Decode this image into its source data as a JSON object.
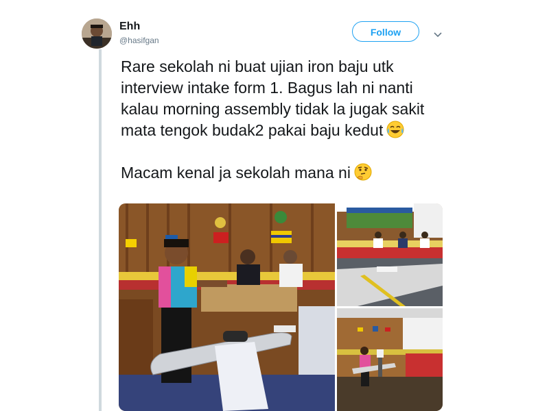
{
  "tweet": {
    "author": {
      "name": "Ehh",
      "handle": "@hasifgan",
      "avatar_icon": "user-avatar"
    },
    "follow_label": "Follow",
    "menu_icon": "chevron-down-icon",
    "paragraphs": [
      "Rare sekolah ni buat ujian iron baju utk interview intake form 1. Bagus lah ni nanti kalau morning assembly tidak la jugak sakit mata tengok budak2 pakai baju kedut",
      "Macam kenal ja sekolah mana ni"
    ],
    "emojis": [
      "face-with-tears-of-joy",
      "thinking-face"
    ],
    "media": {
      "count": 3,
      "photos": [
        "boy-ironing-shirt-meeting-room",
        "conference-table-with-panel",
        "classroom-ironing-station"
      ]
    }
  },
  "colors": {
    "accent": "#1da1f2",
    "thread_line": "#cfd9de",
    "text": "#14171a",
    "muted": "#657786"
  }
}
